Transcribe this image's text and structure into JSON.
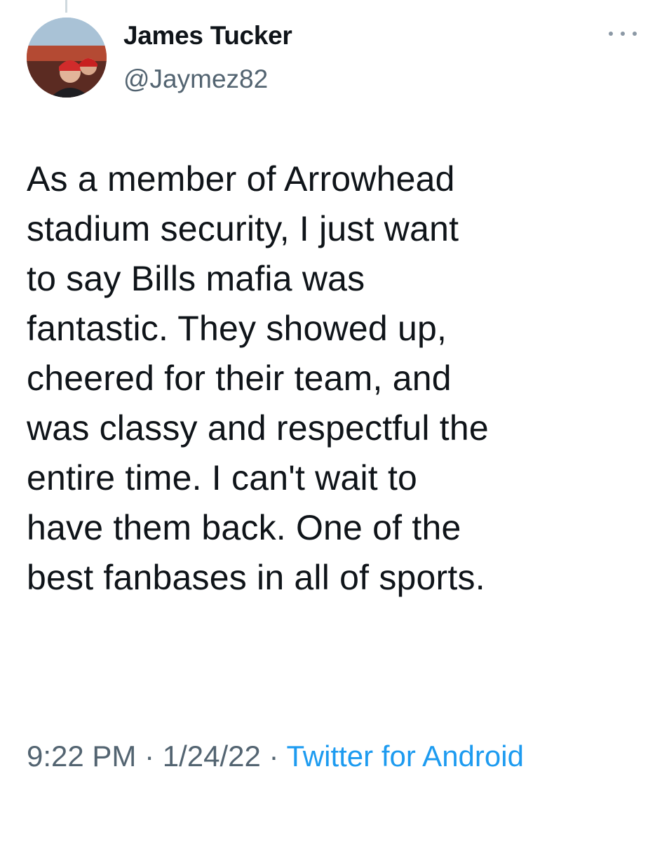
{
  "tweet": {
    "author": {
      "display_name": "James Tucker",
      "handle": "@Jaymez82",
      "avatar": "profile-photo"
    },
    "more_icon": "more-horizontal-icon",
    "text": "As a member of Arrowhead\nstadium security, I just want\nto say Bills mafia was\nfantastic. They showed up,\ncheered for their team, and\nwas classy and respectful the\nentire time. I can't wait to\nhave them back. One of the\nbest fanbases in all of sports.",
    "time": "9:22 PM",
    "separator": " · ",
    "date": "1/24/22",
    "source": "Twitter for Android"
  },
  "colors": {
    "text": "#0f1419",
    "secondary": "#536471",
    "link": "#1d9bf0"
  }
}
